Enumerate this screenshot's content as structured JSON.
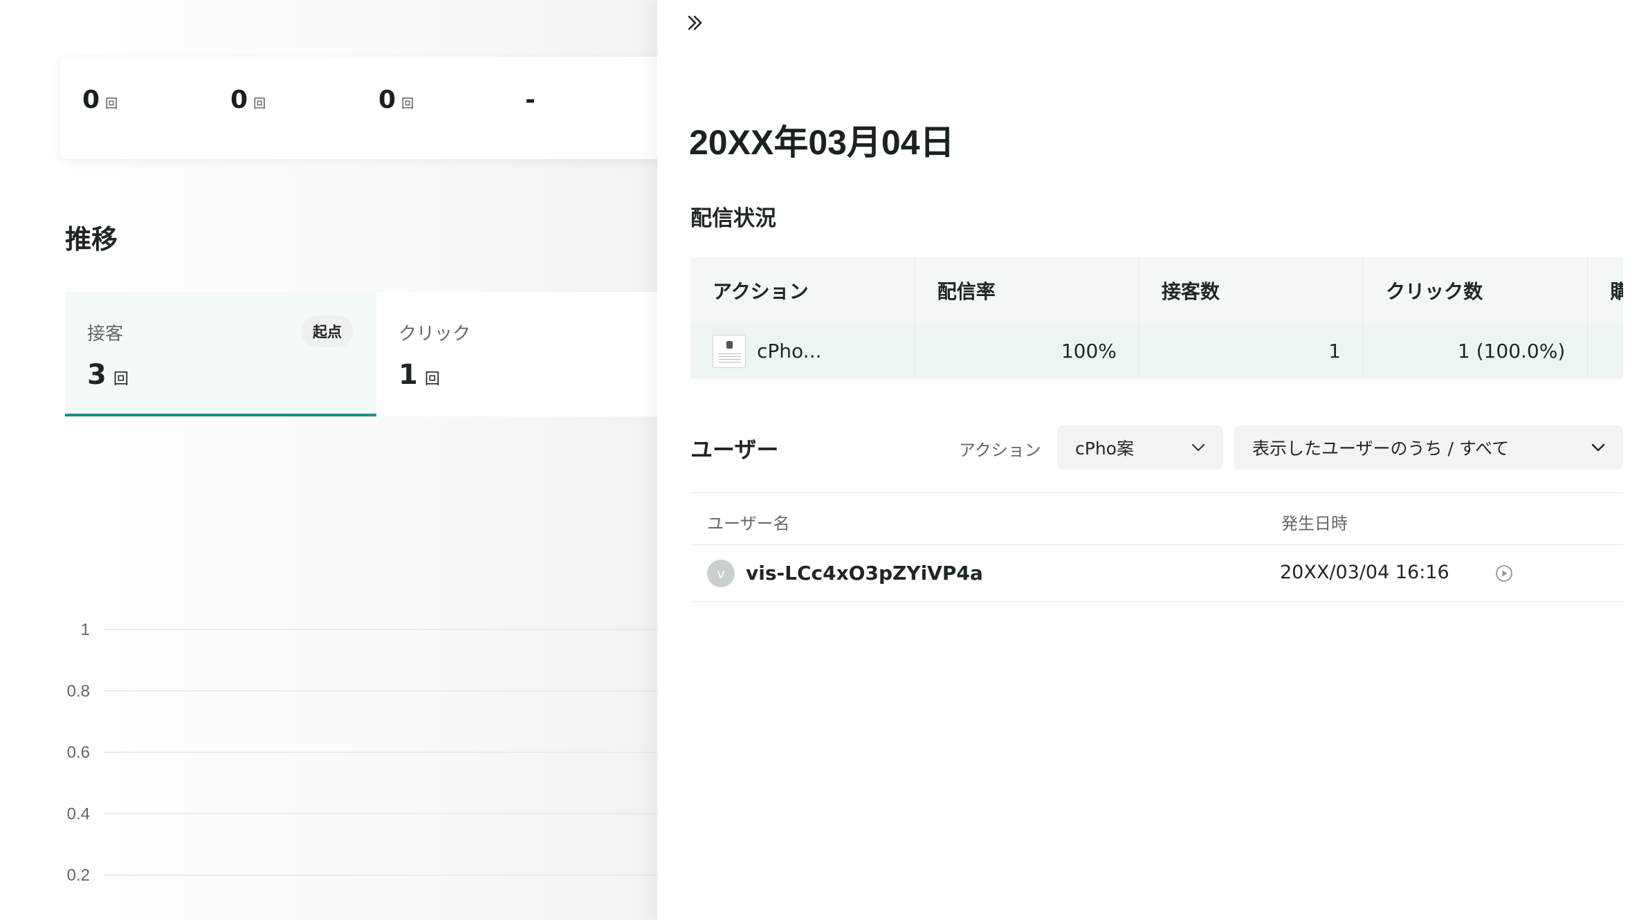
{
  "background": {
    "stats": [
      {
        "value": "0",
        "unit": "回"
      },
      {
        "value": "0",
        "unit": "回"
      },
      {
        "value": "0",
        "unit": "回"
      },
      {
        "value": "-",
        "unit": ""
      }
    ],
    "section_title": "推移",
    "metric_tabs": [
      {
        "label": "接客",
        "value": "3",
        "unit": "回",
        "badge": "起点",
        "active": true
      },
      {
        "label": "クリック",
        "value": "1",
        "unit": "回",
        "active": false
      }
    ],
    "chart_data": {
      "type": "line",
      "title": "",
      "xlabel": "",
      "ylabel": "",
      "y_ticks": [
        "1",
        "0.8",
        "0.6",
        "0.4",
        "0.2"
      ],
      "ylim": [
        0,
        1
      ],
      "grid": true,
      "series": []
    }
  },
  "drawer": {
    "collapse_icon": "double-chevron-right-icon",
    "title": "20XX年03月04日",
    "delivery_heading": "配信状況",
    "table": {
      "headers": [
        "アクション",
        "配信率",
        "接客数",
        "クリック数",
        "購入数"
      ],
      "rows": [
        {
          "action": "cPho...",
          "rate": "100%",
          "serves": "1",
          "clicks": "1 (100.0%)",
          "purchases": ""
        }
      ]
    },
    "users": {
      "heading": "ユーザー",
      "filter_label": "アクション",
      "action_select": "cPho案",
      "scope_select": "表示したユーザーのうち / すべて",
      "columns": {
        "name": "ユーザー名",
        "datetime": "発生日時"
      },
      "rows": [
        {
          "avatar": "v",
          "name": "vis-LCc4xO3pZYiVP4a",
          "datetime": "20XX/03/04 16:16"
        }
      ]
    }
  },
  "colors": {
    "accent": "#14908f",
    "table_header": "#f4f7f7",
    "table_row": "#ecf4f4"
  }
}
